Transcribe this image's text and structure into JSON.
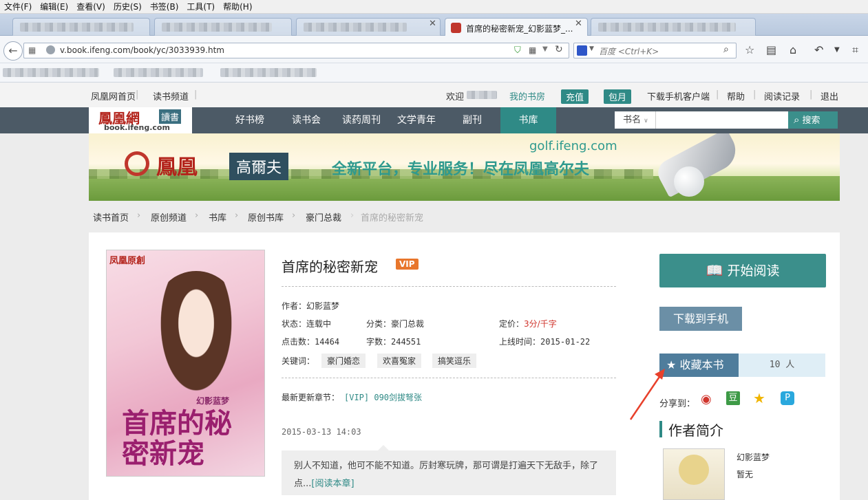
{
  "browser": {
    "menu": [
      "文件(F)",
      "编辑(E)",
      "查看(V)",
      "历史(S)",
      "书签(B)",
      "工具(T)",
      "帮助(H)"
    ],
    "active_tab_title": "首席的秘密新宠_幻影蓝梦_...",
    "url": "v.book.ifeng.com/book/yc/3033939.htm",
    "search_placeholder": "百度 <Ctrl+K>"
  },
  "site": {
    "top_links": {
      "home": "凤凰网首页",
      "read_channel": "读书频道",
      "welcome": "欢迎",
      "my_shelf": "我的书房",
      "recharge": "充值",
      "monthly": "包月",
      "download_client": "下载手机客户端",
      "help": "帮助",
      "history": "阅读记录",
      "logout": "退出"
    },
    "logo": {
      "main": "鳳凰網",
      "badge": "讀書",
      "domain": "book.ifeng.com"
    },
    "nav": [
      "好书榜",
      "读书会",
      "读药周刊",
      "文学青年",
      "副刊",
      "书库"
    ],
    "search": {
      "scope": "书名",
      "button": "搜索"
    },
    "banner": {
      "brand": "鳳凰",
      "badge": "高爾夫",
      "slogan": "全新平台，专业服务！尽在凤凰高尔夫",
      "domain": "golf.ifeng.com"
    },
    "breadcrumbs": [
      "读书首页",
      "原创频道",
      "书库",
      "原创书库",
      "豪门总裁",
      "首席的秘密新宠"
    ]
  },
  "book": {
    "title": "首席的秘密新宠",
    "vip": "VIP",
    "cover": {
      "brand": "凤凰原創",
      "title": "首席的秘密新宠",
      "author": "幻影蓝梦"
    },
    "author": "作者：幻影蓝梦",
    "status": "状态：连载中",
    "category": "分类：豪门总裁",
    "price_label": "定价：",
    "price_value": "3分/千字",
    "clicks": "点击数：14464",
    "words": "字数：244551",
    "online_time": "上线时间：2015-01-22",
    "keywords_label": "关键词：",
    "keywords": [
      "豪门婚恋",
      "欢喜冤家",
      "搞笑逗乐"
    ],
    "latest_label": "最新更新章节：",
    "latest_chapter": "[VIP] 090剑拔弩张",
    "update_time": "2015-03-13 14:03",
    "excerpt": "别人不知道，他可不能不知道。厉封寒玩牌，那可谓是打遍天下无敌手，除了点...",
    "read_chapter": "[阅读本章]"
  },
  "sidebar": {
    "start_reading": "开始阅读",
    "download_phone": "下载到手机",
    "collect": "收藏本书",
    "collect_count": "10 人",
    "share_label": "分享到：",
    "author_intro_title": "作者简介",
    "author_name": "幻影蓝梦",
    "author_desc": "暂无"
  },
  "colors": {
    "teal": "#2f8a86",
    "nav_bg": "#4c5a66",
    "annotation_arrow": "#e8402b",
    "price": "#d0342c"
  }
}
